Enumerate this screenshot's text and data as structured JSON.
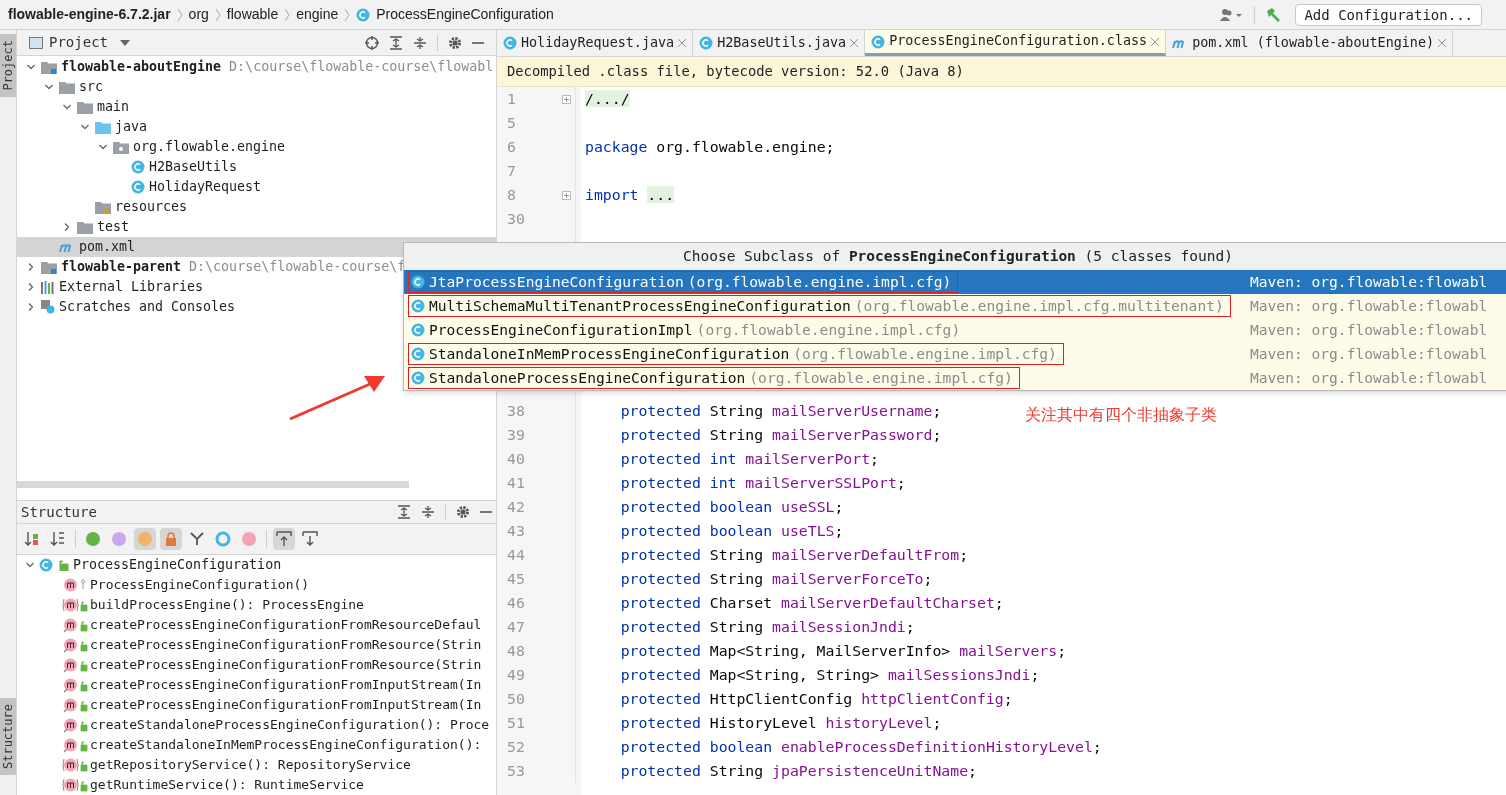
{
  "breadcrumb": [
    {
      "text": "flowable-engine-6.7.2.jar",
      "kind": "jar"
    },
    {
      "text": "org",
      "kind": "package"
    },
    {
      "text": "flowable",
      "kind": "package"
    },
    {
      "text": "engine",
      "kind": "package"
    },
    {
      "text": "ProcessEngineConfiguration",
      "kind": "class"
    }
  ],
  "toolbar": {
    "run_config": "Add Configuration..."
  },
  "side_tabs": [
    {
      "label": "Project",
      "selected": true
    },
    {
      "label": "Structure",
      "selected": true
    }
  ],
  "project": {
    "title": "Project",
    "tree": [
      {
        "label": "flowable-aboutEngine",
        "kind": "module",
        "bold": true,
        "path": "D:\\course\\flowable-course\\flowabl",
        "expanded": true,
        "children": [
          {
            "label": "src",
            "kind": "folder",
            "expanded": true,
            "children": [
              {
                "label": "main",
                "kind": "folder",
                "expanded": true,
                "children": [
                  {
                    "label": "java",
                    "kind": "source",
                    "expanded": true,
                    "children": [
                      {
                        "label": "org.flowable.engine",
                        "kind": "package",
                        "expanded": true,
                        "children": [
                          {
                            "label": "H2BaseUtils",
                            "kind": "class"
                          },
                          {
                            "label": "HolidayRequest",
                            "kind": "class"
                          }
                        ]
                      }
                    ]
                  },
                  {
                    "label": "resources",
                    "kind": "resources"
                  }
                ]
              },
              {
                "label": "test",
                "kind": "folder",
                "expanded": false
              }
            ]
          },
          {
            "label": "pom.xml",
            "kind": "maven",
            "selected": true
          }
        ]
      },
      {
        "label": "flowable-parent",
        "kind": "module",
        "bold": true,
        "path": "D:\\course\\flowable-course\\f",
        "expanded": false
      },
      {
        "label": "External Libraries",
        "kind": "libraries",
        "expanded": false
      },
      {
        "label": "Scratches and Consoles",
        "kind": "scratches",
        "expanded": false
      }
    ]
  },
  "structure": {
    "title": "Structure",
    "root": {
      "label": "ProcessEngineConfiguration",
      "expanded": true,
      "children": [
        {
          "label": "ProcessEngineConfiguration()",
          "kind": "constructor"
        },
        {
          "label": "buildProcessEngine(): ProcessEngine",
          "kind": "abstract"
        },
        {
          "label": "createProcessEngineConfigurationFromResourceDefaul",
          "kind": "static"
        },
        {
          "label": "createProcessEngineConfigurationFromResource(Strin",
          "kind": "static"
        },
        {
          "label": "createProcessEngineConfigurationFromResource(Strin",
          "kind": "static"
        },
        {
          "label": "createProcessEngineConfigurationFromInputStream(In",
          "kind": "static"
        },
        {
          "label": "createProcessEngineConfigurationFromInputStream(In",
          "kind": "static"
        },
        {
          "label": "createStandaloneProcessEngineConfiguration(): Proce",
          "kind": "static"
        },
        {
          "label": "createStandaloneInMemProcessEngineConfiguration():",
          "kind": "static"
        },
        {
          "label": "getRepositoryService(): RepositoryService",
          "kind": "abstract"
        },
        {
          "label": "getRuntimeService(): RuntimeService",
          "kind": "abstract"
        }
      ]
    }
  },
  "editor": {
    "tabs": [
      {
        "label": "HolidayRequest.java",
        "kind": "class",
        "selected": false
      },
      {
        "label": "H2BaseUtils.java",
        "kind": "class",
        "selected": false
      },
      {
        "label": "ProcessEngineConfiguration.class",
        "kind": "compiled",
        "selected": true
      },
      {
        "label": "pom.xml (flowable-aboutEngine)",
        "kind": "maven",
        "selected": false
      }
    ],
    "banner": "Decompiled .class file, bytecode version: 52.0 (Java 8)",
    "lines_top": [
      {
        "n": "1",
        "fold": true,
        "tokens": [
          {
            "text": "/.../",
            "kind": "folded"
          }
        ]
      },
      {
        "n": "5"
      },
      {
        "n": "6",
        "tokens": [
          {
            "text": "package ",
            "kind": "keyword"
          },
          {
            "text": "org.flowable.engine;",
            "kind": "plain"
          }
        ]
      },
      {
        "n": "7"
      },
      {
        "n": "8",
        "fold": true,
        "tokens": [
          {
            "text": "import ",
            "kind": "keyword"
          },
          {
            "text": "...",
            "kind": "folded"
          }
        ]
      },
      {
        "n": "30"
      }
    ],
    "lines_bottom": [
      {
        "n": "38",
        "tokens": [
          {
            "text": "    protected ",
            "kind": "keyword"
          },
          {
            "text": "String ",
            "kind": "plain"
          },
          {
            "text": "mailServerUsername",
            "kind": "field"
          },
          {
            "text": ";",
            "kind": "plain"
          }
        ]
      },
      {
        "n": "39",
        "tokens": [
          {
            "text": "    protected ",
            "kind": "keyword"
          },
          {
            "text": "String ",
            "kind": "plain"
          },
          {
            "text": "mailServerPassword",
            "kind": "field"
          },
          {
            "text": ";",
            "kind": "plain"
          }
        ]
      },
      {
        "n": "40",
        "tokens": [
          {
            "text": "    protected ",
            "kind": "keyword"
          },
          {
            "text": "int ",
            "kind": "keyword"
          },
          {
            "text": "mailServerPort",
            "kind": "field"
          },
          {
            "text": ";",
            "kind": "plain"
          }
        ]
      },
      {
        "n": "41",
        "tokens": [
          {
            "text": "    protected ",
            "kind": "keyword"
          },
          {
            "text": "int ",
            "kind": "keyword"
          },
          {
            "text": "mailServerSSLPort",
            "kind": "field"
          },
          {
            "text": ";",
            "kind": "plain"
          }
        ]
      },
      {
        "n": "42",
        "tokens": [
          {
            "text": "    protected ",
            "kind": "keyword"
          },
          {
            "text": "boolean ",
            "kind": "keyword"
          },
          {
            "text": "useSSL",
            "kind": "field"
          },
          {
            "text": ";",
            "kind": "plain"
          }
        ]
      },
      {
        "n": "43",
        "tokens": [
          {
            "text": "    protected ",
            "kind": "keyword"
          },
          {
            "text": "boolean ",
            "kind": "keyword"
          },
          {
            "text": "useTLS",
            "kind": "field"
          },
          {
            "text": ";",
            "kind": "plain"
          }
        ]
      },
      {
        "n": "44",
        "tokens": [
          {
            "text": "    protected ",
            "kind": "keyword"
          },
          {
            "text": "String ",
            "kind": "plain"
          },
          {
            "text": "mailServerDefaultFrom",
            "kind": "field"
          },
          {
            "text": ";",
            "kind": "plain"
          }
        ]
      },
      {
        "n": "45",
        "tokens": [
          {
            "text": "    protected ",
            "kind": "keyword"
          },
          {
            "text": "String ",
            "kind": "plain"
          },
          {
            "text": "mailServerForceTo",
            "kind": "field"
          },
          {
            "text": ";",
            "kind": "plain"
          }
        ]
      },
      {
        "n": "46",
        "tokens": [
          {
            "text": "    protected ",
            "kind": "keyword"
          },
          {
            "text": "Charset ",
            "kind": "plain"
          },
          {
            "text": "mailServerDefaultCharset",
            "kind": "field"
          },
          {
            "text": ";",
            "kind": "plain"
          }
        ]
      },
      {
        "n": "47",
        "tokens": [
          {
            "text": "    protected ",
            "kind": "keyword"
          },
          {
            "text": "String ",
            "kind": "plain"
          },
          {
            "text": "mailSessionJndi",
            "kind": "field"
          },
          {
            "text": ";",
            "kind": "plain"
          }
        ]
      },
      {
        "n": "48",
        "tokens": [
          {
            "text": "    protected ",
            "kind": "keyword"
          },
          {
            "text": "Map<String, MailServerInfo> ",
            "kind": "plain"
          },
          {
            "text": "mailServers",
            "kind": "field"
          },
          {
            "text": ";",
            "kind": "plain"
          }
        ]
      },
      {
        "n": "49",
        "tokens": [
          {
            "text": "    protected ",
            "kind": "keyword"
          },
          {
            "text": "Map<String, String> ",
            "kind": "plain"
          },
          {
            "text": "mailSessionsJndi",
            "kind": "field"
          },
          {
            "text": ";",
            "kind": "plain"
          }
        ]
      },
      {
        "n": "50",
        "tokens": [
          {
            "text": "    protected ",
            "kind": "keyword"
          },
          {
            "text": "HttpClientConfig ",
            "kind": "plain"
          },
          {
            "text": "httpClientConfig",
            "kind": "field"
          },
          {
            "text": ";",
            "kind": "plain"
          }
        ]
      },
      {
        "n": "51",
        "tokens": [
          {
            "text": "    protected ",
            "kind": "keyword"
          },
          {
            "text": "HistoryLevel ",
            "kind": "plain"
          },
          {
            "text": "historyLevel",
            "kind": "field"
          },
          {
            "text": ";",
            "kind": "plain"
          }
        ]
      },
      {
        "n": "52",
        "tokens": [
          {
            "text": "    protected ",
            "kind": "keyword"
          },
          {
            "text": "boolean ",
            "kind": "keyword"
          },
          {
            "text": "enableProcessDefinitionHistoryLevel",
            "kind": "field"
          },
          {
            "text": ";",
            "kind": "plain"
          }
        ]
      },
      {
        "n": "53",
        "tokens": [
          {
            "text": "    protected ",
            "kind": "keyword"
          },
          {
            "text": "String ",
            "kind": "plain"
          },
          {
            "text": "jpaPersistenceUnitName",
            "kind": "field"
          },
          {
            "text": ";",
            "kind": "plain"
          }
        ]
      }
    ]
  },
  "popup": {
    "title_prefix": "Choose Subclass of",
    "title_class": "ProcessEngineConfiguration",
    "title_suffix": "(5 classes found)",
    "items": [
      {
        "name": "JtaProcessEngineConfiguration",
        "package": "(org.flowable.engine.impl.cfg)",
        "source": "Maven: org.flowable:flowabl",
        "selected": true,
        "boxed": true
      },
      {
        "name": "MultiSchemaMultiTenantProcessEngineConfiguration",
        "package": "(org.flowable.engine.impl.cfg.multitenant)",
        "source": "Maven: org.flowable:flowabl",
        "selected": false,
        "boxed": true
      },
      {
        "name": "ProcessEngineConfigurationImpl",
        "package": "(org.flowable.engine.impl.cfg)",
        "source": "Maven: org.flowable:flowabl",
        "selected": false,
        "boxed": false
      },
      {
        "name": "StandaloneInMemProcessEngineConfiguration",
        "package": "(org.flowable.engine.impl.cfg)",
        "source": "Maven: org.flowable:flowabl",
        "selected": false,
        "boxed": true
      },
      {
        "name": "StandaloneProcessEngineConfiguration",
        "package": "(org.flowable.engine.impl.cfg)",
        "source": "Maven: org.flowable:flowabl",
        "selected": false,
        "boxed": true
      }
    ]
  },
  "annotation": {
    "note": "关注其中有四个非抽象子类"
  }
}
